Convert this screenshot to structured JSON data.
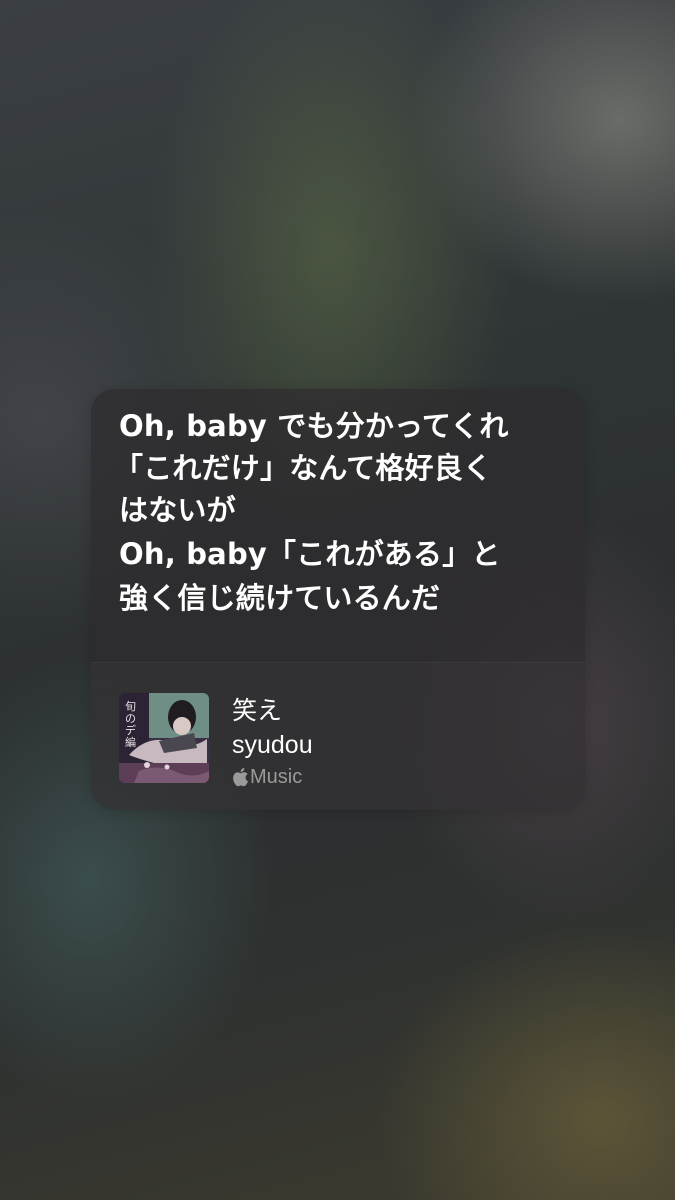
{
  "lyrics": {
    "lines": [
      "Oh, baby でも分かってくれ",
      "「これだけ」なんて格好良く",
      "はないが",
      "Oh, baby「これがある」と",
      "強く信じ続けているんだ"
    ]
  },
  "song": {
    "title": "笑え",
    "artist": "syudou",
    "service": "Music",
    "art_text": "旬のデ編"
  },
  "icons": {
    "service_icon": "apple-logo-icon"
  }
}
